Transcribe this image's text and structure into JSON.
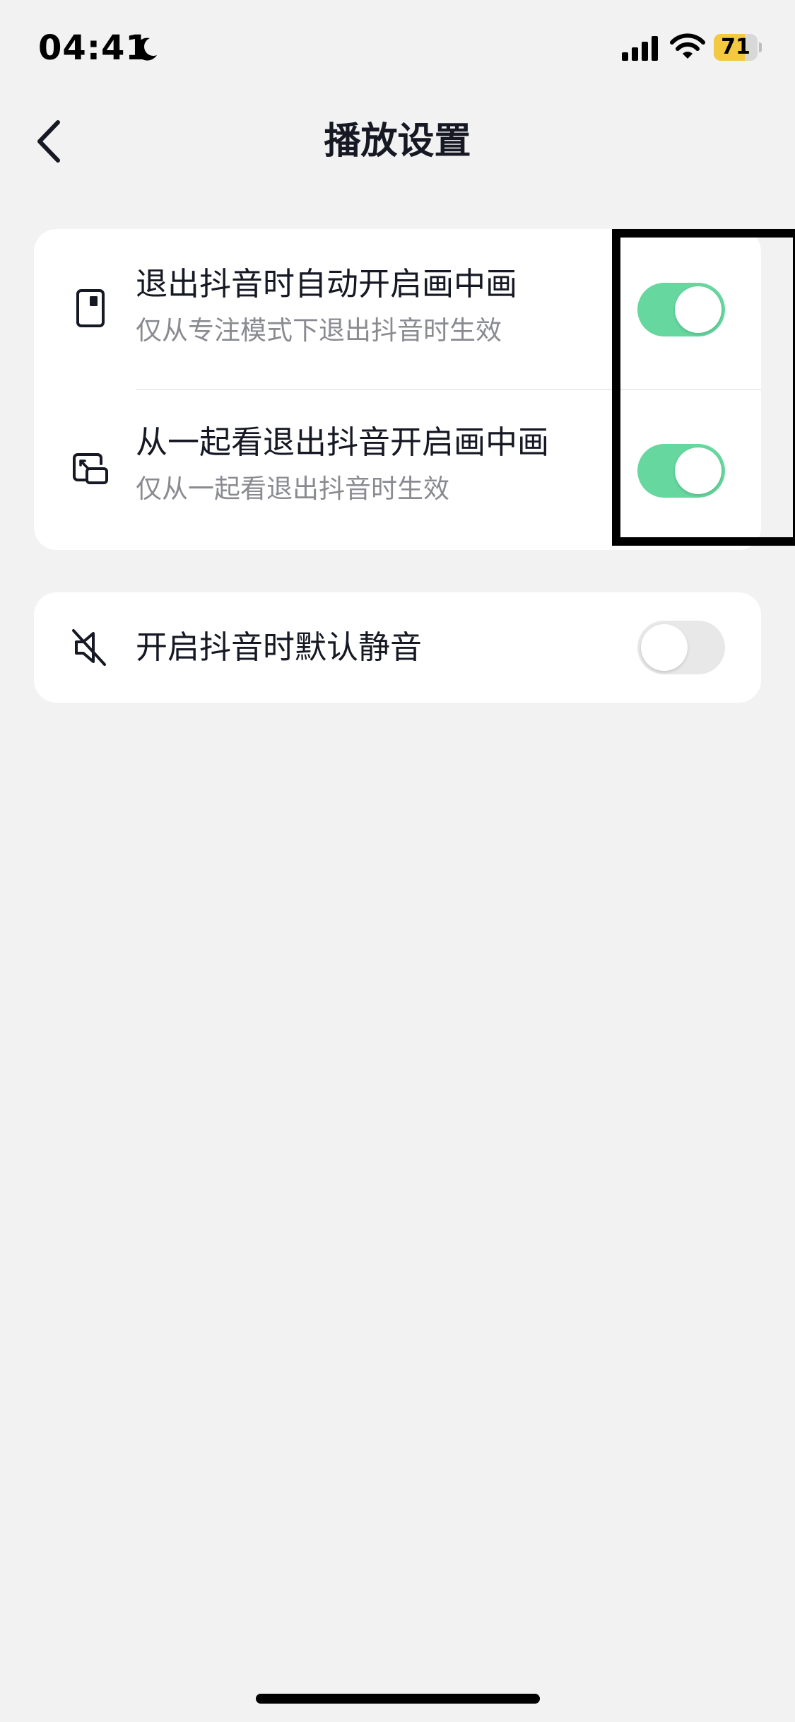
{
  "status_bar": {
    "time": "04:41",
    "battery": "71",
    "battery_level": 0.71,
    "icons": [
      "moon-icon",
      "signal-icon",
      "wifi-icon",
      "battery-icon"
    ]
  },
  "nav": {
    "back_icon": "chevron-left-icon",
    "title": "播放设置"
  },
  "settings": {
    "group1": [
      {
        "icon": "pip-phone-icon",
        "title": "退出抖音时自动开启画中画",
        "subtitle": "仅从专注模式下退出抖音时生效",
        "enabled": true
      },
      {
        "icon": "pip-window-icon",
        "title": "从一起看退出抖音开启画中画",
        "subtitle": "仅从一起看退出抖音时生效",
        "enabled": true
      }
    ],
    "group2": [
      {
        "icon": "mute-speaker-icon",
        "title": "开启抖音时默认静音",
        "enabled": false
      }
    ]
  },
  "colors": {
    "toggle_on": "#66d79e",
    "toggle_off": "#e8e8e9",
    "background": "#f2f2f2",
    "battery": "#f4c940",
    "highlight": "#000000"
  }
}
